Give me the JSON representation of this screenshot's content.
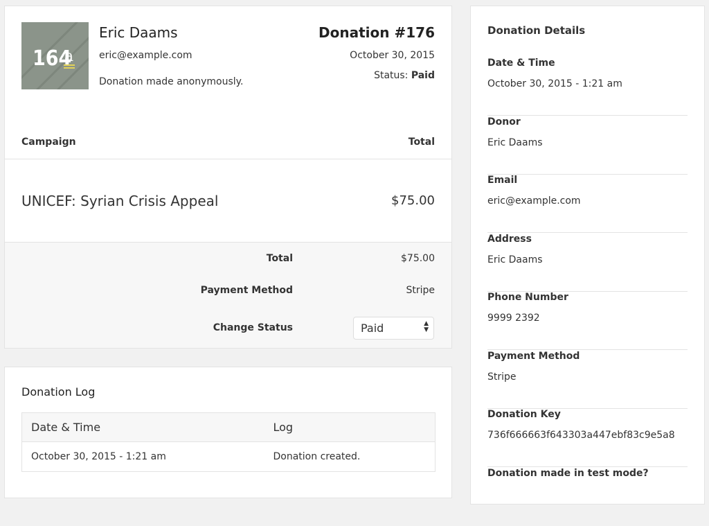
{
  "donor": {
    "name": "Eric Daams",
    "email": "eric@example.com",
    "note": "Donation made anonymously.",
    "avatar_text": "164a"
  },
  "donation": {
    "title": "Donation #176",
    "date": "October 30, 2015",
    "status_label": "Status:",
    "status": "Paid"
  },
  "items_table": {
    "headers": [
      "Campaign",
      "Total"
    ],
    "rows": [
      {
        "campaign": "UNICEF: Syrian Crisis Appeal",
        "total": "$75.00"
      }
    ]
  },
  "summary": {
    "total_label": "Total",
    "total": "$75.00",
    "method_label": "Payment Method",
    "method": "Stripe",
    "change_status_label": "Change Status",
    "status_selected": "Paid"
  },
  "log": {
    "title": "Donation Log",
    "headers": [
      "Date & Time",
      "Log"
    ],
    "rows": [
      {
        "date": "October 30, 2015 - 1:21 am",
        "log": "Donation created."
      }
    ]
  },
  "details": {
    "title": "Donation Details",
    "items": [
      {
        "label": "Date & Time",
        "value": "October 30, 2015 - 1:21 am"
      },
      {
        "label": "Donor",
        "value": "Eric Daams"
      },
      {
        "label": "Email",
        "value": "eric@example.com"
      },
      {
        "label": "Address",
        "value": "Eric Daams"
      },
      {
        "label": "Phone Number",
        "value": "9999 2392"
      },
      {
        "label": "Payment Method",
        "value": "Stripe"
      },
      {
        "label": "Donation Key",
        "value": "736f666663f643303a447ebf83c9e5a8"
      },
      {
        "label": "Donation made in test mode?",
        "value": ""
      }
    ]
  }
}
